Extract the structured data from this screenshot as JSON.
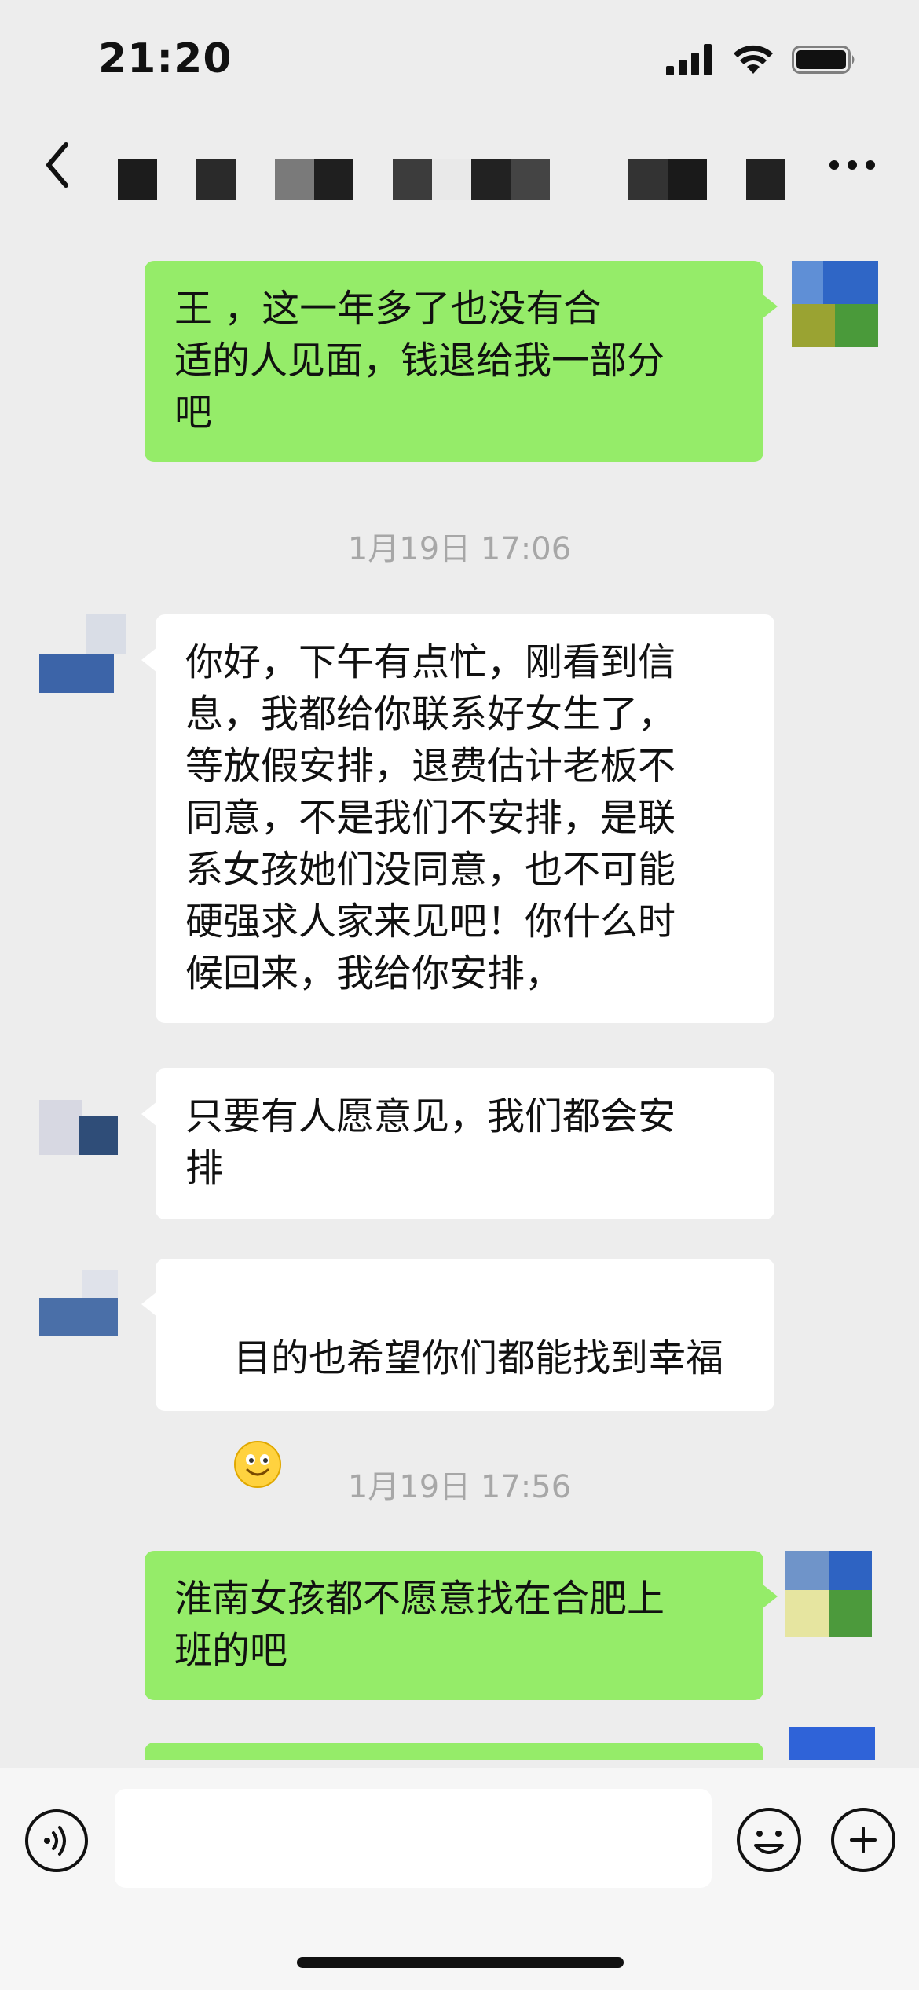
{
  "status_bar": {
    "time": "21:20"
  },
  "nav": {
    "title_obscured": true
  },
  "messages": [
    {
      "side": "me",
      "text": "王 ，这一年多了也没有合适的人见面，钱退给我一部分吧"
    },
    {
      "timestamp": "1月19日 17:06"
    },
    {
      "side": "other",
      "text": "你好，下午有点忙，刚看到信息，我都给你联系好女生了，等放假安排，退费估计老板不同意，不是我们不安排，是联系女孩她们没同意，也不可能硬强求人家来见吧！你什么时候回来，我给你安排，"
    },
    {
      "side": "other",
      "text": "只要有人愿意见，我们都会安排"
    },
    {
      "side": "other",
      "text": "目的也希望你们都能找到幸福",
      "emoji": "smile"
    },
    {
      "timestamp": "1月19日 17:56"
    },
    {
      "side": "me",
      "text": "淮南女孩都不愿意找在合肥上班的吧"
    }
  ],
  "ts1": "1月19日 17:06",
  "ts2": "1月19日 17:56",
  "m1": "王 ，这一年多了也没有合\n适的人见面，钱退给我一部分\n吧",
  "m2": "你好，下午有点忙，刚看到信\n息，我都给你联系好女生了，\n等放假安排，退费估计老板不\n同意，不是我们不安排，是联\n系女孩她们没同意，也不可能\n硬强求人家来见吧！你什么时\n候回来，我给你安排，",
  "m3": "只要有人愿意见，我们都会安\n排",
  "m4": "目的也希望你们都能找到幸福",
  "m5": "淮南女孩都不愿意找在合肥上\n班的吧",
  "colors": {
    "my_bubble": "#95ec69",
    "other_bubble": "#ffffff",
    "background": "#ededed",
    "timestamp": "#a7a7a7"
  },
  "icons": [
    "back-arrow-icon",
    "more-icon",
    "voice-icon",
    "emoji-icon",
    "plus-icon",
    "signal-icon",
    "wifi-icon",
    "battery-icon"
  ]
}
